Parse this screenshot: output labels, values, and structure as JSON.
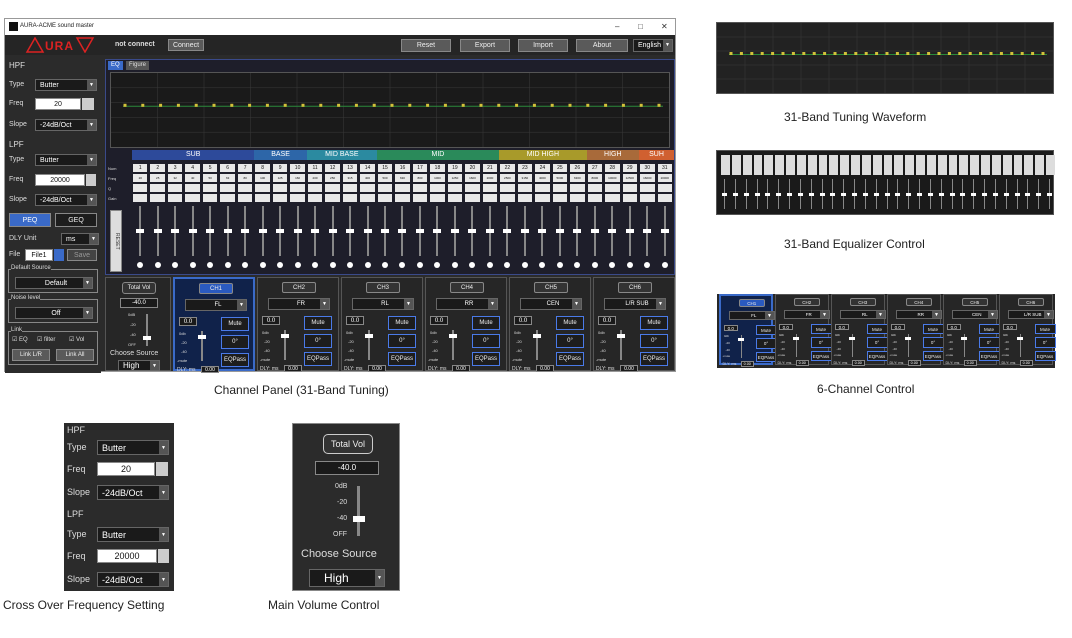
{
  "window": {
    "title": "AURA-ACME sound master",
    "controls": [
      "–",
      "□",
      "✕"
    ]
  },
  "topbar": {
    "logo": "AURA",
    "status": "not connect",
    "connect": "Connect",
    "reset": "Reset",
    "export": "Export",
    "import": "Import",
    "about": "About",
    "language": "English"
  },
  "hpf": {
    "title": "HPF",
    "type_label": "Type",
    "type": "Butter",
    "freq_label": "Freq",
    "freq": "20",
    "slope_label": "Slope",
    "slope": "-24dB/Oct"
  },
  "lpf": {
    "title": "LPF",
    "type_label": "Type",
    "type": "Butter",
    "freq_label": "Freq",
    "freq": "20000",
    "slope_label": "Slope",
    "slope": "-24dB/Oct"
  },
  "modes": {
    "peq": "PEQ",
    "geq": "GEQ"
  },
  "dly": {
    "label": "DLY Unit",
    "value": "ms"
  },
  "file": {
    "label": "File",
    "value": "File1",
    "save": "Save"
  },
  "default_source": {
    "label": "Default Source",
    "value": "Default"
  },
  "noise": {
    "label": "Noise level",
    "value": "Off"
  },
  "link": {
    "label": "Link",
    "eq": "EQ",
    "filter": "filter",
    "vol": "Vol",
    "link_lr": "Link L/R",
    "link_all": "Link All"
  },
  "eq_tabs": {
    "eq": "EQ",
    "figure": "Figure"
  },
  "bands": [
    {
      "name": "SUB",
      "color": "#2d4a9a"
    },
    {
      "name": "BASE",
      "color": "#2d66a8"
    },
    {
      "name": "MID BASE",
      "color": "#2b8aa0"
    },
    {
      "name": "MID",
      "color": "#2a8a5a"
    },
    {
      "name": "MID HIGH",
      "color": "#a89a2a"
    },
    {
      "name": "HIGH",
      "color": "#a86a3a"
    },
    {
      "name": "SUH",
      "color": "#d06030"
    }
  ],
  "eq_row_labels": [
    "Num",
    "Freq",
    "Q",
    "Gain"
  ],
  "band_nums": [
    "1",
    "2",
    "3",
    "4",
    "5",
    "6",
    "7",
    "8",
    "9",
    "10",
    "11",
    "12",
    "13",
    "14",
    "15",
    "16",
    "17",
    "18",
    "19",
    "20",
    "21",
    "22",
    "23",
    "24",
    "25",
    "26",
    "27",
    "28",
    "29",
    "30",
    "31"
  ],
  "band_freqs": [
    "20",
    "25",
    "32",
    "40",
    "50",
    "63",
    "80",
    "100",
    "125",
    "160",
    "200",
    "250",
    "315",
    "400",
    "500",
    "630",
    "800",
    "1000",
    "1250",
    "1600",
    "2000",
    "2500",
    "3150",
    "4000",
    "5000",
    "6300",
    "8000",
    "10000",
    "12500",
    "16000",
    "20000"
  ],
  "reset_v": "RESET",
  "master": {
    "total_vol": "Total Vol",
    "value": "-40.0",
    "marks": [
      "0dB",
      "-20",
      "-40",
      "OFF"
    ],
    "choose": "Choose Source",
    "source": "High"
  },
  "channels": [
    {
      "id": "CH1",
      "name": "FL"
    },
    {
      "id": "CH2",
      "name": "FR"
    },
    {
      "id": "CH3",
      "name": "RL"
    },
    {
      "id": "CH4",
      "name": "RR"
    },
    {
      "id": "CH5",
      "name": "CEN"
    },
    {
      "id": "CH6",
      "name": "L/R SUB"
    }
  ],
  "ch_common": {
    "vol": "0.0",
    "mute": "Mute",
    "phase": "0°",
    "eqpass": "EQPass",
    "dly_label": "DLY: ms",
    "dly": "0.00",
    "marks": [
      "0db",
      "-20",
      "-40",
      "-mute"
    ]
  },
  "captions": {
    "waveform": "31-Band Tuning Waveform",
    "equalizer": "31-Band Equalizer Control",
    "channel_panel": "Channel Panel (31-Band Tuning)",
    "six_channel": "6-Channel Control",
    "crossover": "Cross Over Frequency Setting",
    "main_volume": "Main Volume Control"
  },
  "colors": {
    "accent": "#3a6ac8",
    "logo": "#d22222",
    "curve": "#d4c23a"
  }
}
